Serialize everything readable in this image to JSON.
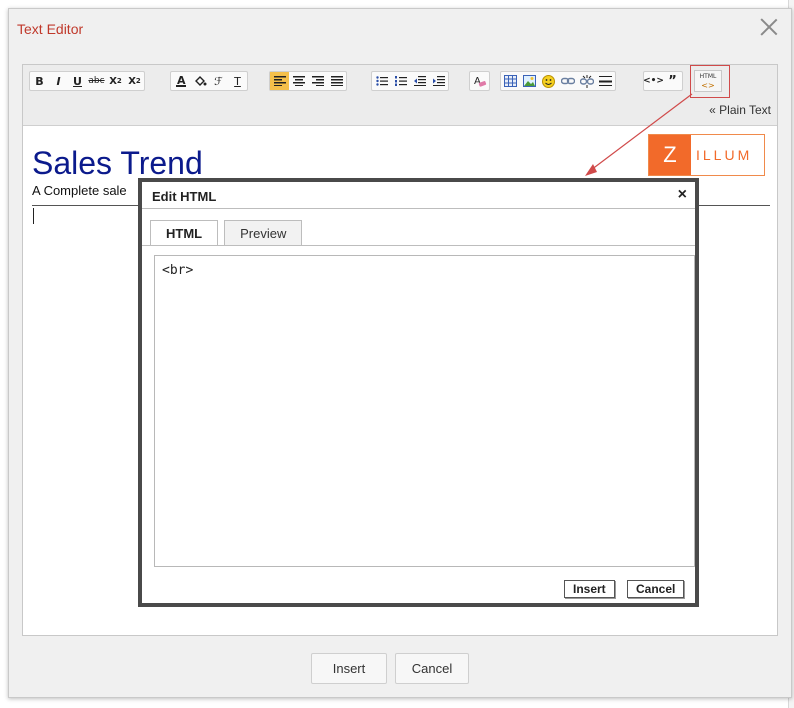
{
  "dialog": {
    "title": "Text Editor",
    "footer": {
      "insert_label": "Insert",
      "cancel_label": "Cancel"
    }
  },
  "toolbar": {
    "groups": [
      {
        "name": "text-format",
        "buttons": [
          "B",
          "I",
          "U",
          "abc",
          "x2",
          "x2"
        ]
      },
      {
        "name": "color-font",
        "buttons": [
          "font-color",
          "highlight",
          "font-family",
          "font-size"
        ]
      },
      {
        "name": "align",
        "buttons": [
          "align-left",
          "align-center",
          "align-right",
          "align-justify"
        ]
      },
      {
        "name": "lists",
        "buttons": [
          "bullet-list",
          "numbered-list",
          "outdent",
          "indent"
        ]
      },
      {
        "name": "clear",
        "buttons": [
          "clear-format"
        ]
      },
      {
        "name": "insert",
        "buttons": [
          "table",
          "image",
          "emoji",
          "link",
          "unlink",
          "horizontal-rule"
        ]
      },
      {
        "name": "code",
        "buttons": [
          "code",
          "quote"
        ]
      }
    ],
    "html_button": {
      "line1": "HTML",
      "line2": "<>"
    },
    "plain_text_link": "« Plain Text"
  },
  "document": {
    "title": "Sales Trend",
    "subtitle": "A Complete sale"
  },
  "logo": {
    "letter": "Z",
    "rest": "ILLUM"
  },
  "html_dialog": {
    "title": "Edit HTML",
    "close": "×",
    "tabs": [
      {
        "label": "HTML",
        "active": true
      },
      {
        "label": "Preview",
        "active": false
      }
    ],
    "content": "<br>",
    "insert_label": "Insert",
    "cancel_label": "Cancel"
  },
  "colors": {
    "title_red": "#c0392b",
    "doc_title_blue": "#0b1a8c",
    "logo_orange": "#f26a2a",
    "active_button": "#f5c04a",
    "arrow_red": "#d04a4a"
  }
}
